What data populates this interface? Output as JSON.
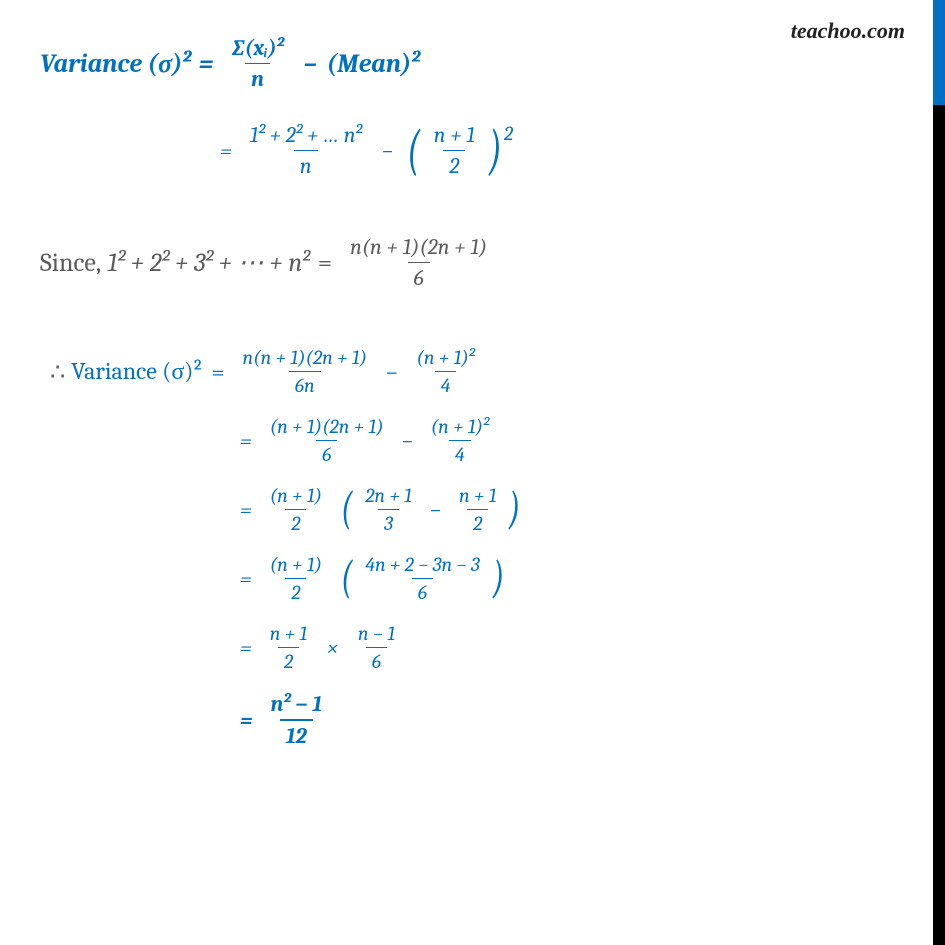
{
  "brand": "teachoo.com",
  "eq1": {
    "label": "Variance (σ)²",
    "eq1": "=",
    "frac1_num": "∑(xᵢ)²",
    "frac1_den": "n",
    "minus": "–",
    "mean": "(Mean)²"
  },
  "eq2": {
    "eq": "=",
    "num": "1² +  2² +  …  n²",
    "den": "n",
    "minus": "−",
    "pnum": "n +  1",
    "pden": "2",
    "exp": "2"
  },
  "since": {
    "label": "Since,",
    "lhs": "1²  +   2² + 3²  + ⋯ + n²",
    "eq": "=",
    "num": "n(n +  1)(2n +  1)",
    "den": "6"
  },
  "l3": {
    "therefore": "∴",
    "label": "Variance (σ)²",
    "eq": "=",
    "num1": "n(n + 1)(2n + 1)",
    "den1": "6n",
    "minus": "−",
    "num2": "(n + 1)²",
    "den2": "4"
  },
  "l4": {
    "eq": "=",
    "num1": "(n + 1)(2n + 1)",
    "den1": "6",
    "minus": "−",
    "num2": "(n + 1)²",
    "den2": "4"
  },
  "l5": {
    "eq": "=",
    "fnum": "(n + 1)",
    "fden": "2",
    "pnum1": "2n + 1",
    "pden1": "3",
    "minus": "−",
    "pnum2": "n + 1",
    "pden2": "2"
  },
  "l6": {
    "eq": "=",
    "fnum": "(n + 1)",
    "fden": "2",
    "pnum": "4n + 2 − 3n − 3",
    "pden": "6"
  },
  "l7": {
    "eq": "=",
    "num1": "n + 1",
    "den1": "2",
    "times": "×",
    "num2": "n − 1",
    "den2": "6"
  },
  "l8": {
    "eq": "=",
    "num": "n² − 1",
    "den": "12"
  }
}
